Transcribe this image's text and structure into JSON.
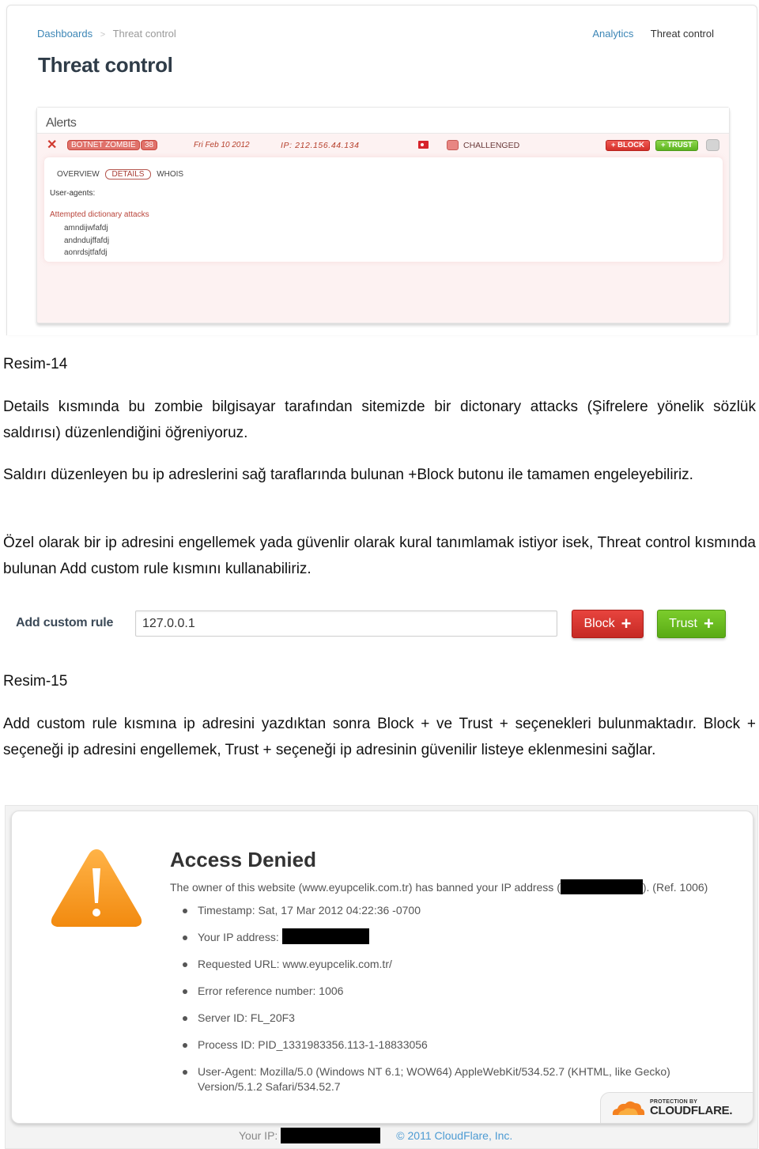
{
  "threat_control": {
    "breadcrumb": {
      "root": "Dashboards",
      "separator": ">",
      "current": "Threat control"
    },
    "top_nav": {
      "analytics": "Analytics",
      "current": "Threat control"
    },
    "title": "Threat control",
    "alerts": {
      "title": "Alerts",
      "row": {
        "close_icon": "✕",
        "type_badge": "BOTNET ZOMBIE",
        "count": "38",
        "date": "Fri Feb 10 2012",
        "ip": "IP: 212.156.44.134",
        "country_flag": "TR",
        "status": "CHALLENGED",
        "block_label": "+ BLOCK",
        "trust_label": "+ TRUST"
      },
      "tabs": [
        "OVERVIEW",
        "DETAILS",
        "WHOIS"
      ],
      "active_tab": "DETAILS",
      "user_agents_label": "User-agents:",
      "attacks_title": "Attempted dictionary attacks",
      "attacks": [
        "amndijwfafdj",
        "andndujffafdj",
        "aonrdsjtfafdj"
      ]
    },
    "colors": {
      "accent_red": "#d5302a",
      "accent_green": "#5cb31f",
      "link": "#3c86b6"
    }
  },
  "document": {
    "caption1": "Resim-14",
    "paragraph1": "Details kısmında bu zombie bilgisayar tarafından sitemizde bir dictonary attacks (Şifrelere yönelik sözlük saldırısı) düzenlendiğini öğreniyoruz.",
    "paragraph2": "Saldırı düzenleyen bu ip adreslerini sağ taraflarında bulunan +Block butonu ile tamamen engeleyebiliriz.",
    "paragraph3": "Özel olarak bir ip adresini engellemek yada güvenlir olarak kural tanımlamak istiyor isek, Threat control kısmında bulunan Add custom rule kısmını kullanabiliriz.",
    "caption2": "Resim-15",
    "paragraph4": "Add custom rule kısmına ip adresini yazdıktan sonra Block + ve Trust + seçenekleri bulunmaktadır. Block + seçeneği ip adresini engellemek, Trust + seçeneği ip adresinin güvenilir listeye eklenmesini sağlar."
  },
  "custom_rule": {
    "label": "Add custom rule",
    "input_value": "127.0.0.1",
    "block_label": "Block",
    "trust_label": "Trust",
    "plus": "+"
  },
  "access_denied": {
    "title": "Access Denied",
    "message_prefix": "The owner of this website (www.eyupcelik.com.tr) has banned your IP address (",
    "message_suffix": "). (Ref. 1006)",
    "items": {
      "timestamp": "Timestamp: Sat, 17 Mar 2012 04:22:36 -0700",
      "ip_label": "Your IP address:",
      "url": "Requested URL: www.eyupcelik.com.tr/",
      "error_ref": "Error reference number: 1006",
      "server_id": "Server ID: FL_20F3",
      "process_id": "Process ID: PID_1331983356.113-1-18833056",
      "user_agent": "User-Agent: Mozilla/5.0 (Windows NT 6.1; WOW64) AppleWebKit/534.52.7 (KHTML, like Gecko)\nVersion/5.1.2 Safari/534.52.7"
    },
    "badge": {
      "small": "PROTECTION BY",
      "brand": "CLOUDFLARE."
    },
    "footer": {
      "ip_label": "Your IP:",
      "copyright": "© 2011 CloudFlare, Inc."
    }
  }
}
